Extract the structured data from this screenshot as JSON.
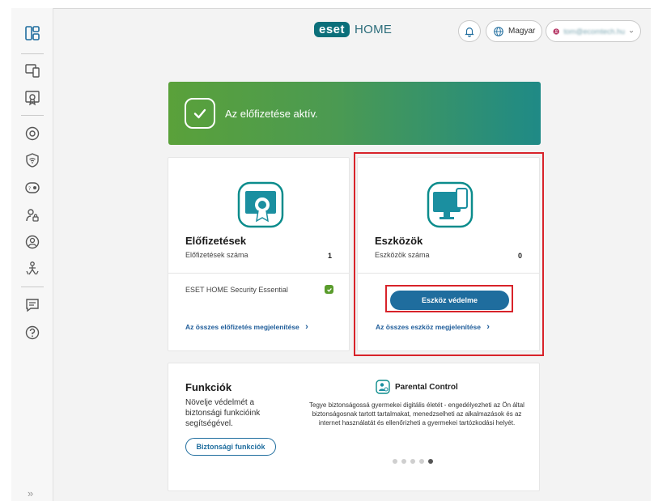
{
  "header": {
    "logo_brand": "eset",
    "logo_product": "HOME",
    "language_label": "Magyar",
    "account_email": "tom@ecomtech.hu"
  },
  "sidebar": {
    "items": [
      {
        "icon": "dashboard-icon"
      },
      {
        "icon": "devices-icon"
      },
      {
        "icon": "certificate-icon"
      },
      {
        "icon": "settings-security-icon"
      },
      {
        "icon": "wifi-shield-icon"
      },
      {
        "icon": "password-manager-icon"
      },
      {
        "icon": "user-lock-icon"
      },
      {
        "icon": "privacy-icon"
      },
      {
        "icon": "parental-control-icon"
      },
      {
        "icon": "feedback-icon"
      },
      {
        "icon": "help-icon"
      }
    ],
    "expand_label": "»"
  },
  "banner": {
    "text": "Az előfizetése aktív."
  },
  "subscriptions_card": {
    "title": "Előfizetések",
    "count_label": "Előfizetések száma",
    "count_value": "1",
    "item_name": "ESET HOME Security Essential",
    "link_label": "Az összes előfizetés megjelenítése",
    "link_arrow": "›"
  },
  "devices_card": {
    "title": "Eszközök",
    "count_label": "Eszközök száma",
    "count_value": "0",
    "button_label": "Eszköz védelme",
    "link_label": "Az összes eszköz megjelenítése",
    "link_arrow": "›"
  },
  "features_card": {
    "title": "Funkciók",
    "description": "Növelje védelmét a biztonsági funkcióink segítségével.",
    "button_label": "Biztonsági funkciók",
    "feature_title": "Parental Control",
    "feature_text": "Tegye biztonságossá gyermekei digitális életét - engedélyezheti az Ön által biztonságosnak tartott tartalmakat, menedzselheti az alkalmazások és az internet használatát és ellenőrizheti a gyermekei tartózkodási helyét.",
    "carousel_total": 5,
    "carousel_active": 5
  },
  "colors": {
    "brand_teal": "#0b6f7a",
    "primary_blue": "#1f6d9e",
    "highlight_red": "#d8232a",
    "success_green": "#5a9c2c"
  }
}
